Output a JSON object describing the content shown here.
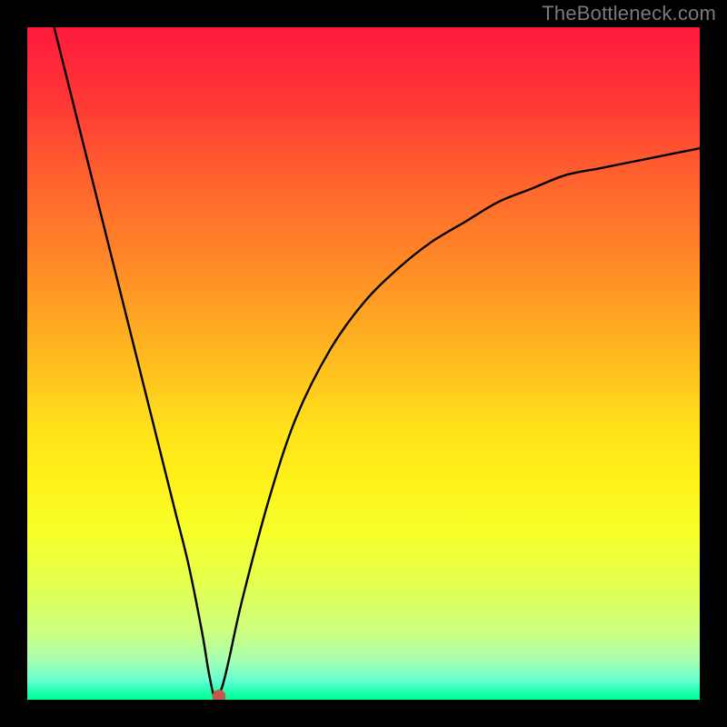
{
  "watermark": "TheBottleneck.com",
  "chart_data": {
    "type": "line",
    "title": "",
    "xlabel": "",
    "ylabel": "",
    "xlim": [
      0,
      100
    ],
    "ylim": [
      0,
      100
    ],
    "grid": false,
    "legend": false,
    "series": [
      {
        "name": "curve",
        "x": [
          4,
          6,
          8,
          10,
          12,
          14,
          16,
          18,
          20,
          22,
          24,
          26,
          27,
          28,
          29,
          30,
          32,
          36,
          40,
          45,
          50,
          55,
          60,
          65,
          70,
          75,
          80,
          85,
          90,
          95,
          100
        ],
        "values": [
          100,
          92,
          84,
          76,
          68,
          60,
          52,
          44,
          36,
          28,
          20,
          10,
          4,
          0,
          2,
          6,
          15,
          30,
          42,
          52,
          59,
          64,
          68,
          71,
          74,
          76,
          78,
          79,
          80,
          81,
          82
        ]
      }
    ],
    "marker": {
      "x": 28.5,
      "y": 0.5,
      "color": "#c05a4a",
      "radius": 1.0
    }
  },
  "gradient_stops": [
    {
      "pct": 0,
      "color": "#ff1a3c"
    },
    {
      "pct": 50,
      "color": "#ffe31a"
    },
    {
      "pct": 100,
      "color": "#00ff90"
    }
  ]
}
